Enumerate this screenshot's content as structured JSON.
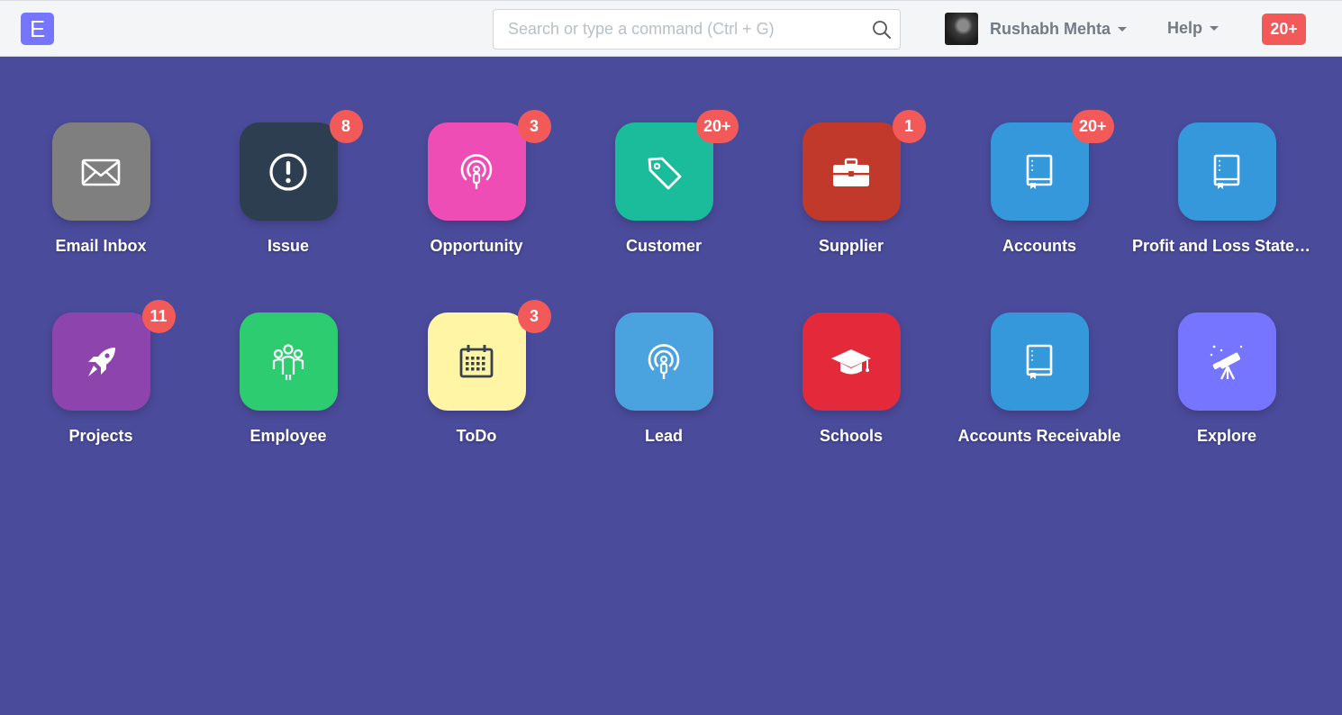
{
  "navbar": {
    "logo_letter": "E",
    "search_placeholder": "Search or type a command (Ctrl + G)",
    "user_name": "Rushabh Mehta",
    "help_label": "Help",
    "notifications": "20+"
  },
  "apps": [
    {
      "label": "Email Inbox",
      "badge": "",
      "color": "#7f7f7f",
      "icon": "envelope-icon"
    },
    {
      "label": "Issue",
      "badge": "8",
      "color": "#2c3e50",
      "icon": "exclamation-circle-icon"
    },
    {
      "label": "Opportunity",
      "badge": "3",
      "color": "#ef4db6",
      "icon": "broadcast-person-icon"
    },
    {
      "label": "Customer",
      "badge": "20+",
      "color": "#1abc9c",
      "icon": "tag-icon"
    },
    {
      "label": "Supplier",
      "badge": "1",
      "color": "#c0392b",
      "icon": "briefcase-icon"
    },
    {
      "label": "Accounts",
      "badge": "20+",
      "color": "#3498db",
      "icon": "book-icon"
    },
    {
      "label": "Profit and Loss Statement",
      "badge": "",
      "color": "#3498db",
      "icon": "book-icon"
    },
    {
      "label": "Projects",
      "badge": "11",
      "color": "#8e44ad",
      "icon": "rocket-icon"
    },
    {
      "label": "Employee",
      "badge": "",
      "color": "#2ecc71",
      "icon": "people-icon"
    },
    {
      "label": "ToDo",
      "badge": "3",
      "color": "#fff5a5",
      "icon": "calendar-icon"
    },
    {
      "label": "Lead",
      "badge": "",
      "color": "#4aa3df",
      "icon": "broadcast-person-icon"
    },
    {
      "label": "Schools",
      "badge": "",
      "color": "#e42a3a",
      "icon": "graduation-cap-icon"
    },
    {
      "label": "Accounts Receivable",
      "badge": "",
      "color": "#3498db",
      "icon": "book-icon"
    },
    {
      "label": "Explore",
      "badge": "",
      "color": "#7575ff",
      "icon": "telescope-icon"
    }
  ]
}
